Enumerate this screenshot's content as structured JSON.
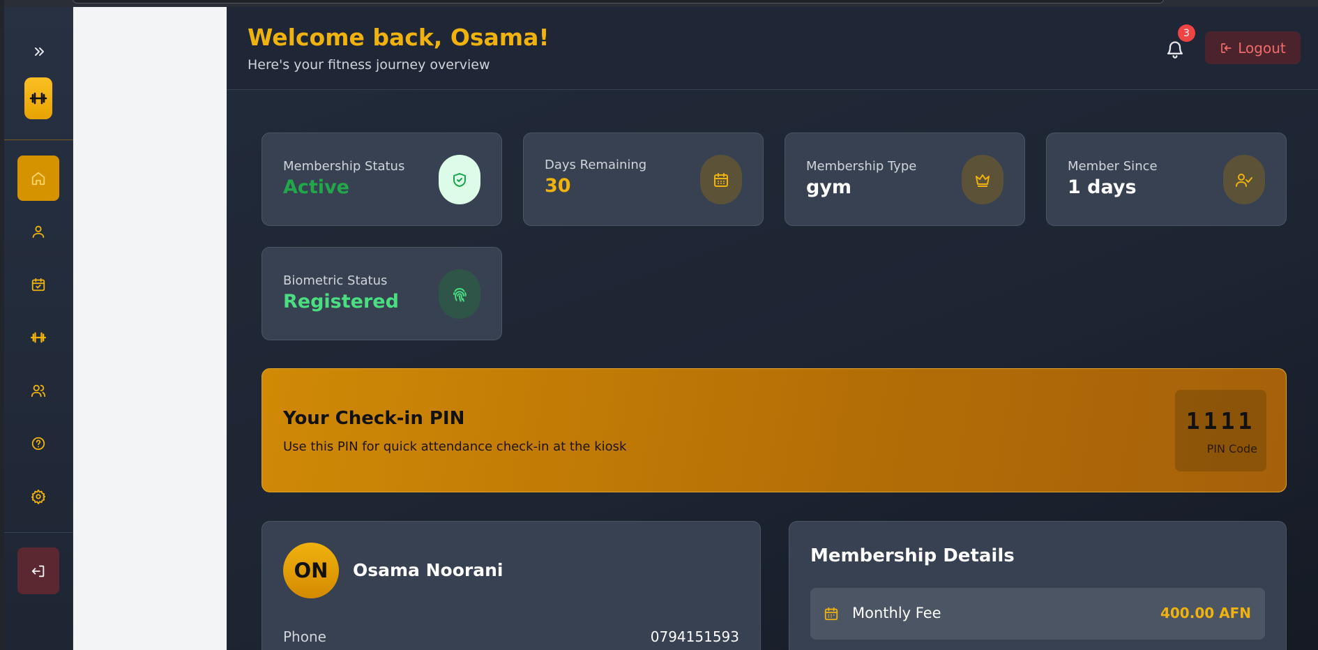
{
  "header": {
    "title": "Welcome back, Osama!",
    "subtitle": "Here's your fitness journey overview",
    "notifications_count": "3",
    "logout_label": "Logout"
  },
  "sidebar": {
    "items": [
      {
        "name": "home",
        "icon": "home-icon"
      },
      {
        "name": "profile",
        "icon": "user-icon"
      },
      {
        "name": "attendance",
        "icon": "calendar-check-icon"
      },
      {
        "name": "workouts",
        "icon": "dumbbell-icon"
      },
      {
        "name": "trainers",
        "icon": "users-icon"
      },
      {
        "name": "help",
        "icon": "help-icon"
      },
      {
        "name": "settings",
        "icon": "gear-icon"
      }
    ]
  },
  "stats": [
    {
      "label": "Membership Status",
      "value": "Active",
      "color": "#22a84a",
      "icon": "shield-check-icon"
    },
    {
      "label": "Days Remaining",
      "value": "30",
      "color": "#f0b20e",
      "icon": "calendar-icon"
    },
    {
      "label": "Membership Type",
      "value": "gym",
      "color": "#ffffff",
      "icon": "crown-icon"
    },
    {
      "label": "Member Since",
      "value": "1 days",
      "color": "#ffffff",
      "icon": "user-check-icon"
    },
    {
      "label": "Biometric Status",
      "value": "Registered",
      "color": "#4ade80",
      "icon": "fingerprint-icon"
    }
  ],
  "pin": {
    "title": "Your Check-in PIN",
    "description": "Use this PIN for quick attendance check-in at the kiosk",
    "code": "1111",
    "code_label": "PIN Code"
  },
  "profile": {
    "initials": "ON",
    "name": "Osama Noorani",
    "phone_label": "Phone",
    "phone_value": "0794151593"
  },
  "membership_details": {
    "title": "Membership Details",
    "fee_label": "Monthly Fee",
    "fee_value": "400.00 AFN"
  },
  "colors": {
    "accent": "#f0b20e",
    "danger": "#ef4444",
    "success": "#22a84a"
  }
}
